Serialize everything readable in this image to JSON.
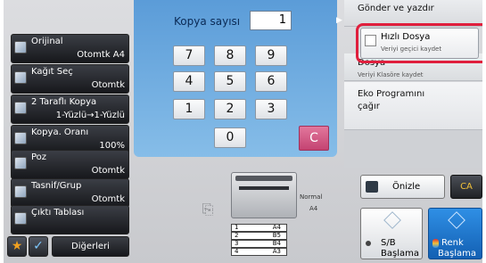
{
  "functions": [
    {
      "name": "Orijinal",
      "value": "Otomtk  A4"
    },
    {
      "name": "Kağıt Seç",
      "value": "Otomtk"
    },
    {
      "name": "2 Taraflı Kopya",
      "value": "1-Yüzlü→1-Yüzlü"
    },
    {
      "name": "Kopya. Oranı",
      "value": "100%"
    },
    {
      "name": "Poz",
      "value": "Otomtk"
    },
    {
      "name": "Tasnif/Grup",
      "value": "Otomtk"
    },
    {
      "name": "Çıktı Tablası",
      "value": ""
    }
  ],
  "bottom_left": {
    "star": "★",
    "check": "✓",
    "others": "Diğerleri"
  },
  "copies": {
    "label": "Kopya sayısı",
    "value": "1"
  },
  "keypad": {
    "k7": "7",
    "k8": "8",
    "k9": "9",
    "k4": "4",
    "k5": "5",
    "k6": "6",
    "k1": "1",
    "k2": "2",
    "k3": "3",
    "k0": "0",
    "clear": "C"
  },
  "preview": {
    "mode": "Normal",
    "size": "A4",
    "trays": [
      {
        "n": "1",
        "s": "A4"
      },
      {
        "n": "2",
        "s": "B5"
      },
      {
        "n": "3",
        "s": "B4"
      },
      {
        "n": "4",
        "s": "A3"
      }
    ]
  },
  "right_panel": {
    "send_print": "Gönder ve yazdır",
    "quick_file": "Hızlı Dosya",
    "quick_file_sub": "Veriyi geçici kaydet",
    "file": "Dosya",
    "file_sub": "Veriyi Klasöre kaydet",
    "eco_line1": "Eko Programını",
    "eco_line2": "çağır"
  },
  "preview_btn": "Önizle",
  "ca_btn": "CA",
  "bw_start": {
    "l1": "S/B",
    "l2": "Başlama"
  },
  "color_start": {
    "l1": "Renk",
    "l2": "Başlama"
  },
  "colors": {
    "accent_blue": "#2a86d9",
    "highlight_red": "#e01f3d",
    "clear_pink": "#d6547e"
  }
}
